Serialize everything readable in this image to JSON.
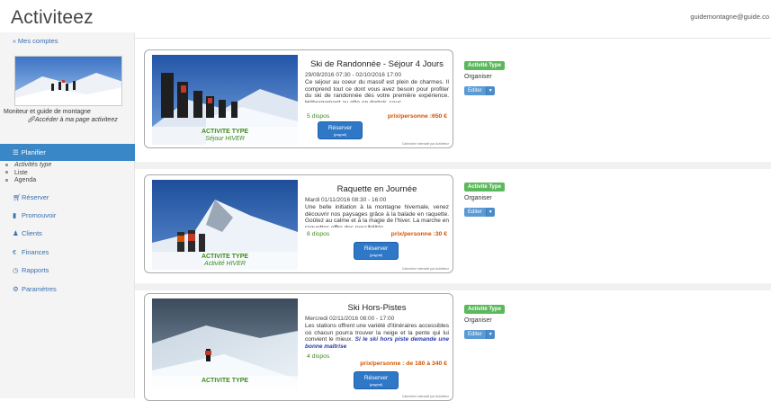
{
  "header": {
    "app_title": "Activiteez",
    "user_email": "guidemontagne@guide.co"
  },
  "sidebar": {
    "back_label": "Mes comptes",
    "profile_role": "Moniteur et guide de montagne",
    "profile_link": "Accéder à ma page activiteez",
    "active_item": "Planifier",
    "sub_items": [
      "Activités type",
      "Liste",
      "Agenda"
    ],
    "items": [
      {
        "label": "Réserver",
        "icon": "cart-icon"
      },
      {
        "label": "Promouvoir",
        "icon": "bullhorn-icon"
      },
      {
        "label": "Clients",
        "icon": "user-icon"
      },
      {
        "label": "Finances",
        "icon": "euro-icon"
      },
      {
        "label": "Rapports",
        "icon": "clock-icon"
      },
      {
        "label": "Paramètres",
        "icon": "gear-icon"
      }
    ]
  },
  "activities": [
    {
      "title": "Ski de Randonnée - Séjour 4 Jours",
      "date": "29/09/2016 07:30 - 02/10/2016 17:00",
      "description": "Ce séjour au coeur du massif est plein de charmes. Il comprend tout ce dont vous avez besoin pour profiter du ski de randonnée dès votre première expérience. Hébergement au gîte en dortoir, sous",
      "warning": "",
      "dispos": "5 dispos",
      "price": "prix/personne :650 €",
      "caption_type": "ACTIVITE TYPE",
      "caption_name": "Séjour HIVER",
      "reserve_label": "Réserver",
      "reserve_sub": "(paypal)",
      "credit": "Calendrier interactif par Activiteez",
      "badge": "Activité Type",
      "organiser": "Organiser",
      "edit": "Editer"
    },
    {
      "title": "Raquette en Journée",
      "date": "Mardi 01/11/2016 08:30 - 16:00",
      "description": "Une belle initiation à la montagne hivernale, venez découvrir nos paysages grâce à la balade en raquette. Goûtez au calme et à la magie de l'hiver. La marche en raquettes offre des possibilités",
      "warning": "",
      "dispos": "8 dispos",
      "price": "prix/personne :30 €",
      "caption_type": "ACTIVITE TYPE",
      "caption_name": "Activité HIVER",
      "reserve_label": "Réserver",
      "reserve_sub": "(paypal)",
      "credit": "Calendrier interactif par Activiteez",
      "badge": "Activité Type",
      "organiser": "Organiser",
      "edit": "Editer"
    },
    {
      "title": "Ski Hors-Pistes",
      "date": "Mercredi 02/11/2016 08:00 - 17:00",
      "description": "Les stations offrent une variété d'itinéraires accessibles où chacun pourra trouver la neige et la pente qui lui convient le mieux.",
      "warning": "Si le ski hors piste demande une bonne maîtrise",
      "dispos": "4 dispos",
      "price": "prix/personne : de 180 à 340 €",
      "caption_type": "ACTIVITE TYPE",
      "caption_name": "",
      "reserve_label": "Réserver",
      "reserve_sub": "(paypal)",
      "credit": "Calendrier interactif par Activiteez",
      "badge": "Activité Type",
      "organiser": "Organiser",
      "edit": "Editer"
    }
  ]
}
